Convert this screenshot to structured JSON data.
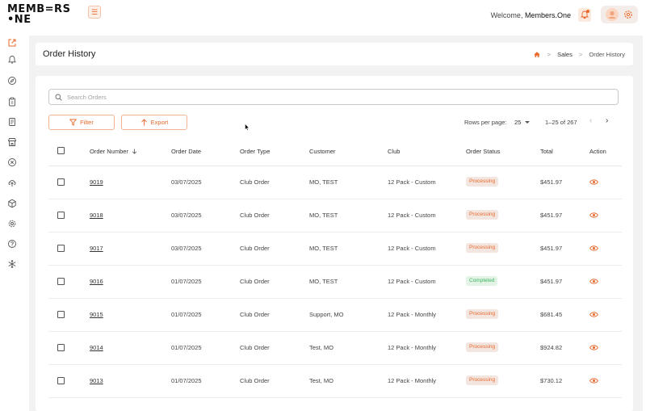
{
  "app": {
    "logo_line1": "MEMB=RS",
    "logo_line2": "•NE",
    "welcome_prefix": "Welcome,",
    "user_name": "Members.One"
  },
  "colors": {
    "accent": "#e8692c",
    "processing_bg": "#f3e6e0",
    "completed_bg": "#e3f4e7",
    "completed_text": "#3cb55e",
    "content_bg": "#f2f2f3"
  },
  "sidebar": {
    "items": [
      {
        "icon": "external-link-icon"
      },
      {
        "icon": "bell-icon"
      },
      {
        "icon": "compass-icon"
      },
      {
        "icon": "clipboard-icon"
      },
      {
        "icon": "document-icon"
      },
      {
        "icon": "store-icon"
      },
      {
        "icon": "cancel-circle-icon"
      },
      {
        "icon": "cloud-upload-icon"
      },
      {
        "icon": "cube-icon"
      },
      {
        "icon": "gear-icon"
      },
      {
        "icon": "help-icon"
      },
      {
        "icon": "snowflake-icon"
      }
    ]
  },
  "page": {
    "title": "Order History",
    "breadcrumb": {
      "section": "Sales",
      "current": "Order History"
    }
  },
  "toolbar": {
    "search_placeholder": "Search Orders",
    "filter_label": "Filter",
    "export_label": "Export",
    "rows_per_page_label": "Rows per page:",
    "rows_per_page_value": "25",
    "range_text": "1–25 of 267"
  },
  "table": {
    "headers": {
      "order_number": "Order Number",
      "order_date": "Order Date",
      "order_type": "Order Type",
      "customer": "Customer",
      "club": "Club",
      "order_status": "Order Status",
      "total": "Total",
      "action": "Action"
    },
    "rows": [
      {
        "order_number": "9019",
        "order_date": "03/07/2025",
        "order_type": "Club Order",
        "customer": "MO, TEST",
        "club": "12 Pack - Custom",
        "status": "Processing",
        "total": "$451.97"
      },
      {
        "order_number": "9018",
        "order_date": "03/07/2025",
        "order_type": "Club Order",
        "customer": "MO, TEST",
        "club": "12 Pack - Custom",
        "status": "Processing",
        "total": "$451.97"
      },
      {
        "order_number": "9017",
        "order_date": "03/07/2025",
        "order_type": "Club Order",
        "customer": "MO, TEST",
        "club": "12 Pack - Custom",
        "status": "Processing",
        "total": "$451.97"
      },
      {
        "order_number": "9016",
        "order_date": "01/07/2025",
        "order_type": "Club Order",
        "customer": "MO, TEST",
        "club": "12 Pack - Custom",
        "status": "Completed",
        "total": "$451.97"
      },
      {
        "order_number": "9015",
        "order_date": "01/07/2025",
        "order_type": "Club Order",
        "customer": "Support, MO",
        "club": "12 Pack - Monthly",
        "status": "Processing",
        "total": "$681.45"
      },
      {
        "order_number": "9014",
        "order_date": "01/07/2025",
        "order_type": "Club Order",
        "customer": "Test, MO",
        "club": "12 Pack - Monthly",
        "status": "Processing",
        "total": "$924.82"
      },
      {
        "order_number": "9013",
        "order_date": "01/07/2025",
        "order_type": "Club Order",
        "customer": "Test, MO",
        "club": "12 Pack - Monthly",
        "status": "Processing",
        "total": "$730.12"
      }
    ]
  }
}
